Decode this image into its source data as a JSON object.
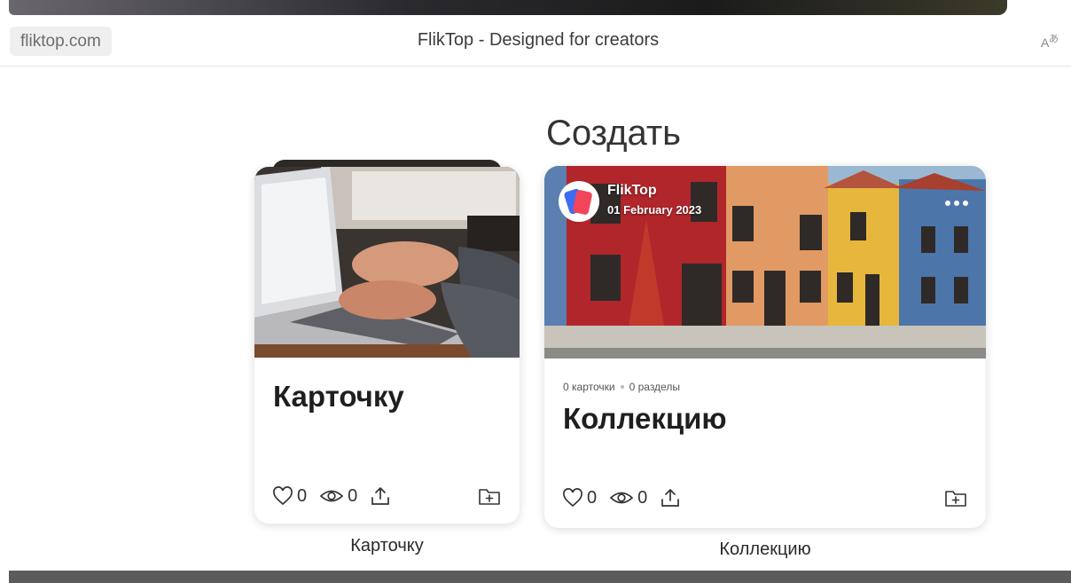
{
  "browser": {
    "domain": "fliktop.com",
    "tab_title": "FlikTop - Designed for creators",
    "translate_glyph_a": "A",
    "translate_glyph_b": "あ"
  },
  "section_title": "Создать",
  "cards": [
    {
      "title": "Карточку",
      "likes": "0",
      "views": "0",
      "caption": "Карточку",
      "image": "laptop-typing-photo"
    },
    {
      "author": "FlikTop",
      "date": "01 February 2023",
      "cards_count": "0 карточки",
      "sections_count": "0 разделы",
      "title": "Коллекцию",
      "likes": "0",
      "views": "0",
      "caption": "Коллекцию",
      "image": "colorful-houses-photo"
    }
  ],
  "icons": {
    "like": "heart-icon",
    "views": "eye-icon",
    "share": "share-icon",
    "add_to_folder": "folder-plus-icon",
    "more": "more-icon",
    "translate": "translate-icon"
  },
  "colors": {
    "avatar_red": "#f2455b",
    "avatar_blue": "#3f6bf2",
    "bottom_bar": "#5b5b5b"
  }
}
